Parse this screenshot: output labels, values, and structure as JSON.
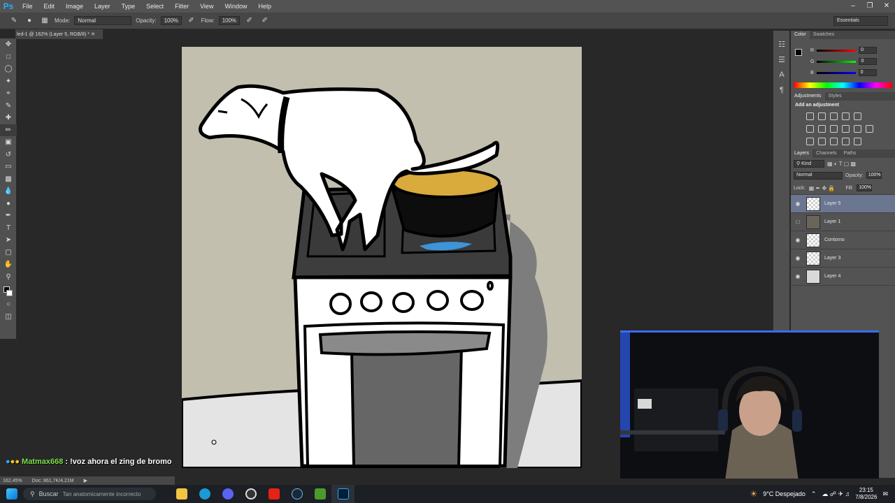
{
  "app": {
    "logo": "Ps"
  },
  "menu": [
    "File",
    "Edit",
    "Image",
    "Layer",
    "Type",
    "Select",
    "Filter",
    "View",
    "Window",
    "Help"
  ],
  "options": {
    "mode_label": "Mode:",
    "mode_value": "Normal",
    "opacity_label": "Opacity:",
    "opacity_value": "100%",
    "flow_label": "Flow:",
    "flow_value": "100%"
  },
  "workspace": "Essentials",
  "document_tab": "led-1 @ 162% (Layer 5, RGB/8) *",
  "color_panel": {
    "tabs": [
      "Color",
      "Swatches"
    ],
    "r_label": "R",
    "r_value": "0",
    "g_label": "G",
    "g_value": "0",
    "b_label": "B",
    "b_value": "0"
  },
  "adjustments_panel": {
    "tabs": [
      "Adjustments",
      "Styles"
    ],
    "heading": "Add an adjustment"
  },
  "layers_panel": {
    "tabs": [
      "Layers",
      "Channels",
      "Paths"
    ],
    "kind_filter": "Kind",
    "blend_mode": "Normal",
    "opacity_label": "Opacity:",
    "opacity_value": "100%",
    "lock_label": "Lock:",
    "fill_label": "Fill:",
    "fill_value": "100%",
    "layers": [
      {
        "name": "Layer 5",
        "visible": true,
        "selected": true
      },
      {
        "name": "Layer 1",
        "visible": false,
        "selected": false
      },
      {
        "name": "Contorno",
        "visible": true,
        "selected": false
      },
      {
        "name": "Layer 3",
        "visible": true,
        "selected": false
      },
      {
        "name": "Layer 4",
        "visible": true,
        "selected": false
      }
    ]
  },
  "status": {
    "zoom": "162,45%",
    "doc": "Doc: 861,7K/4,21M"
  },
  "chat": {
    "username": "Matmax668",
    "message": ": !voz ahora el zing de bromo",
    "overlay_partial": "Tan anatomicamente incorrecto"
  },
  "taskbar": {
    "search": "Buscar",
    "weather": "9°C Despejado",
    "time": "23:15",
    "date": "7/8/2026"
  },
  "colors": {
    "accent": "#31a8ff",
    "selected_layer": "#6b7690",
    "canvas_wall": "#c2bfae"
  }
}
